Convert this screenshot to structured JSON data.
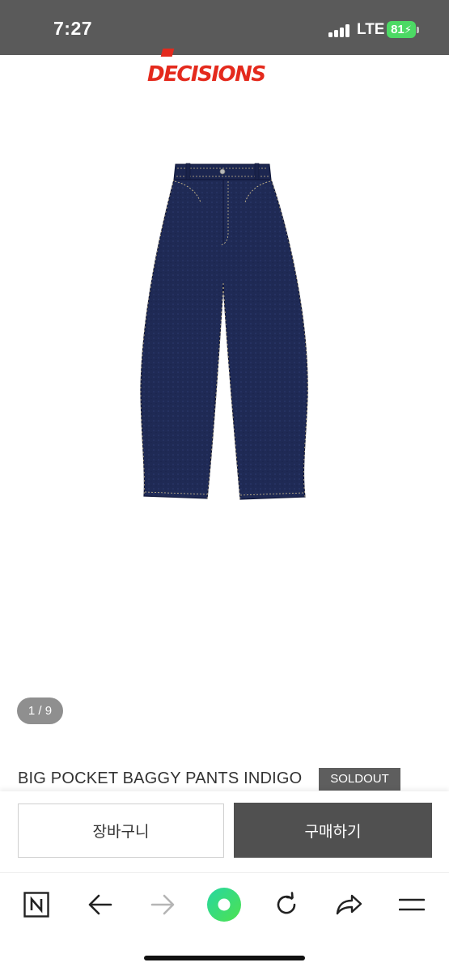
{
  "status_bar": {
    "time": "7:27",
    "network": "LTE",
    "battery": "81",
    "icons": [
      "signal-icon",
      "battery-charging-icon"
    ]
  },
  "brand": {
    "logo_text": "DECISIONS",
    "color": "#e42a1d"
  },
  "product": {
    "image_icon": "indigo-denim-baggy-pants",
    "pager": "1 / 9",
    "title": "BIG POCKET BAGGY PANTS INDIGO",
    "badge": "SOLDOUT"
  },
  "actions": {
    "cart_label": "장바구니",
    "buy_label": "구매하기"
  },
  "browser_toolbar": {
    "items": [
      {
        "icon": "naver-n-icon"
      },
      {
        "icon": "back-arrow-icon"
      },
      {
        "icon": "forward-arrow-icon"
      },
      {
        "icon": "green-home-icon"
      },
      {
        "icon": "refresh-icon"
      },
      {
        "icon": "share-icon"
      },
      {
        "icon": "menu-icon"
      }
    ]
  },
  "colors": {
    "status_bar": "#5a5a5a",
    "badge": "#5e5e5e",
    "buy_button": "#505050",
    "accent_green": "#3ddc84",
    "denim": "#1f2a55"
  }
}
